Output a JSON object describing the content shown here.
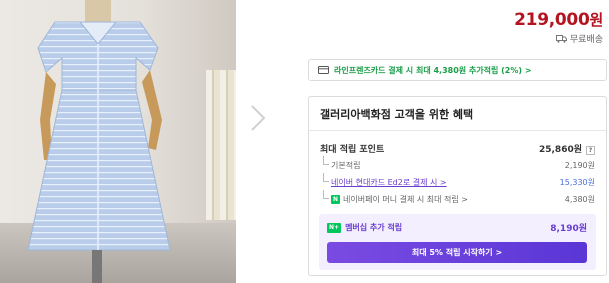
{
  "price": {
    "amount": "219,000",
    "currency": "원"
  },
  "shipping": {
    "label": "무료배송",
    "icon": "truck-icon"
  },
  "card_banner": {
    "text": "라인프렌즈카드 결제 시 최대 4,380원 추가적립 (2%) >",
    "icon": "card-icon",
    "color": "#1a9e48"
  },
  "benefit": {
    "title": "갤러리아백화점 고객을 위한 혜택",
    "max_points": {
      "label": "최대 적립 포인트",
      "value": "25,860원",
      "help": "?"
    },
    "items": [
      {
        "label": "기본적립",
        "value": "2,190원"
      },
      {
        "label": "네이버 현대카드 Ed2로 결제 시 >",
        "value": "15,330원"
      },
      {
        "label": "네이버페이 머니 결제 시 최대 적립 >",
        "value": "4,380원",
        "badge": "N"
      }
    ],
    "membership": {
      "badge": "N+",
      "label": "멤버십 추가 적립",
      "value": "8,190원",
      "cta": "최대 5% 적립 시작하기 >"
    }
  },
  "colors": {
    "price": "#b3141f",
    "accent": "#6a3ecf",
    "naver_green": "#03c75a"
  }
}
